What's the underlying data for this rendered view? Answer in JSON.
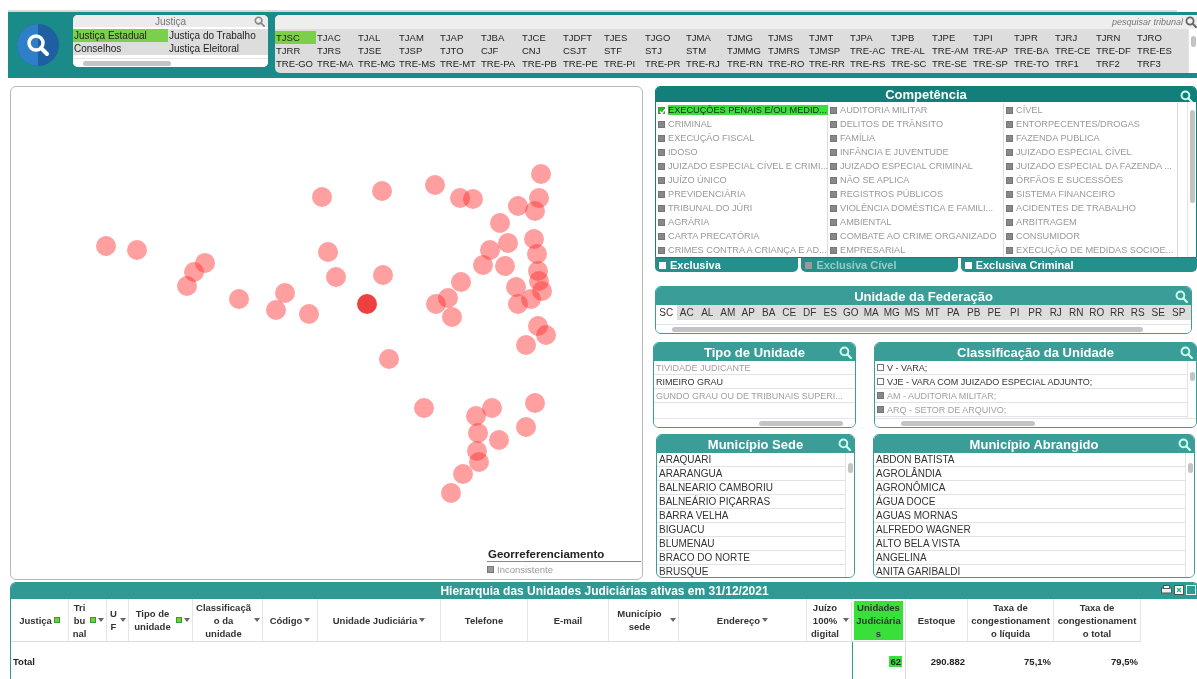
{
  "justica": {
    "title": "Justiça",
    "items": [
      {
        "label": "Justiça Estadual",
        "selected": true
      },
      {
        "label": "Justiça do Trabalho",
        "selected": false
      },
      {
        "label": "Conselhos",
        "selected": false
      },
      {
        "label": "Justiça Eleitoral",
        "selected": false
      }
    ]
  },
  "tribunal": {
    "placeholder": "pesquisar tribunal",
    "items": [
      {
        "label": "TJSC",
        "selected": true
      },
      {
        "label": "TJAC",
        "selected": false
      },
      {
        "label": "TJAL",
        "selected": false
      },
      {
        "label": "TJAM",
        "selected": false
      },
      {
        "label": "TJAP",
        "selected": false
      },
      {
        "label": "TJBA",
        "selected": false
      },
      {
        "label": "TJCE",
        "selected": false
      },
      {
        "label": "TJDFT",
        "selected": false
      },
      {
        "label": "TJES",
        "selected": false
      },
      {
        "label": "TJGO",
        "selected": false
      },
      {
        "label": "TJMA",
        "selected": false
      },
      {
        "label": "TJMG",
        "selected": false
      },
      {
        "label": "TJMS",
        "selected": false
      },
      {
        "label": "TJMT",
        "selected": false
      },
      {
        "label": "TJPA",
        "selected": false
      },
      {
        "label": "TJPB",
        "selected": false
      },
      {
        "label": "TJPE",
        "selected": false
      },
      {
        "label": "TJPI",
        "selected": false
      },
      {
        "label": "TJPR",
        "selected": false
      },
      {
        "label": "TJRJ",
        "selected": false
      },
      {
        "label": "TJRN",
        "selected": false
      },
      {
        "label": "TJRO",
        "selected": false
      },
      {
        "label": "TJRR",
        "selected": false
      },
      {
        "label": "TJRS",
        "selected": false
      },
      {
        "label": "TJSE",
        "selected": false
      },
      {
        "label": "TJSP",
        "selected": false
      },
      {
        "label": "TJTO",
        "selected": false
      },
      {
        "label": "CJF",
        "selected": false
      },
      {
        "label": "CNJ",
        "selected": false
      },
      {
        "label": "CSJT",
        "selected": false
      },
      {
        "label": "STF",
        "selected": false
      },
      {
        "label": "STJ",
        "selected": false
      },
      {
        "label": "STM",
        "selected": false
      },
      {
        "label": "TJMMG",
        "selected": false
      },
      {
        "label": "TJMRS",
        "selected": false
      },
      {
        "label": "TJMSP",
        "selected": false
      },
      {
        "label": "TRE-AC",
        "selected": false
      },
      {
        "label": "TRE-AL",
        "selected": false
      },
      {
        "label": "TRE-AM",
        "selected": false
      },
      {
        "label": "TRE-AP",
        "selected": false
      },
      {
        "label": "TRE-BA",
        "selected": false
      },
      {
        "label": "TRE-CE",
        "selected": false
      },
      {
        "label": "TRE-DF",
        "selected": false
      },
      {
        "label": "TRE-ES",
        "selected": false
      },
      {
        "label": "TRE-GO",
        "selected": false
      },
      {
        "label": "TRE-MA",
        "selected": false
      },
      {
        "label": "TRE-MG",
        "selected": false
      },
      {
        "label": "TRE-MS",
        "selected": false
      },
      {
        "label": "TRE-MT",
        "selected": false
      },
      {
        "label": "TRE-PA",
        "selected": false
      },
      {
        "label": "TRE-PB",
        "selected": false
      },
      {
        "label": "TRE-PE",
        "selected": false
      },
      {
        "label": "TRE-PI",
        "selected": false
      },
      {
        "label": "TRE-PR",
        "selected": false
      },
      {
        "label": "TRE-RJ",
        "selected": false
      },
      {
        "label": "TRE-RN",
        "selected": false
      },
      {
        "label": "TRE-RO",
        "selected": false
      },
      {
        "label": "TRE-RR",
        "selected": false
      },
      {
        "label": "TRE-RS",
        "selected": false
      },
      {
        "label": "TRE-SC",
        "selected": false
      },
      {
        "label": "TRE-SE",
        "selected": false
      },
      {
        "label": "TRE-SP",
        "selected": false
      },
      {
        "label": "TRE-TO",
        "selected": false
      },
      {
        "label": "TRF1",
        "selected": false
      },
      {
        "label": "TRF2",
        "selected": false
      },
      {
        "label": "TRF3",
        "selected": false
      }
    ]
  },
  "map": {
    "legend": {
      "title": "Georreferenciamento",
      "items": [
        {
          "label": "Inconsistente",
          "color": "#999999"
        }
      ]
    }
  },
  "competencia": {
    "title": "Competência",
    "items": [
      {
        "label": "EXECUÇÕES PENAIS E/OU MEDID...",
        "selected": true
      },
      {
        "label": "CRIMINAL",
        "selected": false
      },
      {
        "label": "EXECUÇÃO FISCAL",
        "selected": false
      },
      {
        "label": "IDOSO",
        "selected": false
      },
      {
        "label": "JUIZADO ESPECIAL CÍVEL E CRIMI...",
        "selected": false
      },
      {
        "label": "JUÍZO ÚNICO",
        "selected": false
      },
      {
        "label": "PREVIDENCIÁRIA",
        "selected": false
      },
      {
        "label": "TRIBUNAL DO JÚRI",
        "selected": false
      },
      {
        "label": "AGRÁRIA",
        "selected": false
      },
      {
        "label": "CARTA PRECATÓRIA",
        "selected": false
      },
      {
        "label": "CRIMES CONTRA A CRIANÇA E AD...",
        "selected": false
      },
      {
        "label": "AUDITORIA MILITAR",
        "selected": false
      },
      {
        "label": "DELITOS DE TRÂNSITO",
        "selected": false
      },
      {
        "label": "FAMÍLIA",
        "selected": false
      },
      {
        "label": "INFÂNCIA E JUVENTUDE",
        "selected": false
      },
      {
        "label": "JUIZADO ESPECIAL CRIMINAL",
        "selected": false
      },
      {
        "label": "NÃO SE APLICA",
        "selected": false
      },
      {
        "label": "REGISTROS PÚBLICOS",
        "selected": false
      },
      {
        "label": "VIOLÊNCIA DOMÉSTICA E FAMILI...",
        "selected": false
      },
      {
        "label": "AMBIENTAL",
        "selected": false
      },
      {
        "label": "COMBATE AO CRIME ORGANIZADO",
        "selected": false
      },
      {
        "label": "EMPRESARIAL",
        "selected": false
      },
      {
        "label": "CÍVEL",
        "selected": false
      },
      {
        "label": "ENTORPECENTES/DROGAS",
        "selected": false
      },
      {
        "label": "FAZENDA PUBLICA",
        "selected": false
      },
      {
        "label": "JUIZADO ESPECIAL CÍVEL",
        "selected": false
      },
      {
        "label": "JUIZADO ESPECIAL DA FAZENDA ...",
        "selected": false
      },
      {
        "label": "ÓRFÃOS E SUCESSÕES",
        "selected": false
      },
      {
        "label": "SISTEMA FINANCEIRO",
        "selected": false
      },
      {
        "label": "ACIDENTES DE TRABALHO",
        "selected": false
      },
      {
        "label": "ARBITRAGEM",
        "selected": false
      },
      {
        "label": "CONSUMIDOR",
        "selected": false
      },
      {
        "label": "EXECUÇÃO DE MEDIDAS SOCIOE...",
        "selected": false
      }
    ],
    "toggles": [
      {
        "label": "Exclusiva",
        "checked": false,
        "disabled": false
      },
      {
        "label": "Exclusiva Cível",
        "checked": false,
        "disabled": true
      },
      {
        "label": "Exclusiva Criminal",
        "checked": false,
        "disabled": false
      }
    ]
  },
  "uf": {
    "title": "Unidade da Federação",
    "items": [
      {
        "label": "SC",
        "excluded": false
      },
      {
        "label": "AC",
        "excluded": true
      },
      {
        "label": "AL",
        "excluded": true
      },
      {
        "label": "AM",
        "excluded": true
      },
      {
        "label": "AP",
        "excluded": true
      },
      {
        "label": "BA",
        "excluded": true
      },
      {
        "label": "CE",
        "excluded": true
      },
      {
        "label": "DF",
        "excluded": true
      },
      {
        "label": "ES",
        "excluded": true
      },
      {
        "label": "GO",
        "excluded": true
      },
      {
        "label": "MA",
        "excluded": true
      },
      {
        "label": "MG",
        "excluded": true
      },
      {
        "label": "MS",
        "excluded": true
      },
      {
        "label": "MT",
        "excluded": true
      },
      {
        "label": "PA",
        "excluded": true
      },
      {
        "label": "PB",
        "excluded": true
      },
      {
        "label": "PE",
        "excluded": true
      },
      {
        "label": "PI",
        "excluded": true
      },
      {
        "label": "PR",
        "excluded": true
      },
      {
        "label": "RJ",
        "excluded": true
      },
      {
        "label": "RN",
        "excluded": true
      },
      {
        "label": "RO",
        "excluded": true
      },
      {
        "label": "RR",
        "excluded": true
      },
      {
        "label": "RS",
        "excluded": true
      },
      {
        "label": "SE",
        "excluded": true
      },
      {
        "label": "SP",
        "excluded": true
      }
    ]
  },
  "tipo_unidade": {
    "title": "Tipo de Unidade",
    "items": [
      {
        "label": "TIVIDADE JUDICANTE",
        "excluded": true
      },
      {
        "label": "RIMEIRO GRAU",
        "excluded": false
      },
      {
        "label": "GUNDO GRAU OU DE TRIBUNAIS SUPERI...",
        "excluded": true
      }
    ]
  },
  "classificacao": {
    "title": "Classificação da Unidade",
    "items": [
      {
        "label": "V - VARA;",
        "excluded": false
      },
      {
        "label": "VJE - VARA COM JUIZADO ESPECIAL ADJUNTO;",
        "excluded": false
      },
      {
        "label": "AM - AUDITORIA MILITAR;",
        "excluded": true
      },
      {
        "label": "ARQ - SETOR DE ARQUIVO;",
        "excluded": true
      }
    ]
  },
  "municipio_sede": {
    "title": "Município Sede",
    "items": [
      {
        "label": "ARAQUARI"
      },
      {
        "label": "ARARANGUA"
      },
      {
        "label": "BALNEARIO CAMBORIU"
      },
      {
        "label": "BALNEÁRIO PIÇARRAS"
      },
      {
        "label": "BARRA VELHA"
      },
      {
        "label": "BIGUACU"
      },
      {
        "label": "BLUMENAU"
      },
      {
        "label": "BRACO DO NORTE"
      },
      {
        "label": "BRUSQUE"
      }
    ]
  },
  "municipio_abrangido": {
    "title": "Município Abrangido",
    "items": [
      {
        "label": "ABDON BATISTA"
      },
      {
        "label": "AGROLÂNDIA"
      },
      {
        "label": "AGRONÔMICA"
      },
      {
        "label": "ÁGUA DOCE"
      },
      {
        "label": "AGUAS MORNAS"
      },
      {
        "label": "ALFREDO WAGNER"
      },
      {
        "label": "ALTO BELA VISTA"
      },
      {
        "label": "ANGELINA"
      },
      {
        "label": "ANITA GARIBALDI"
      }
    ]
  },
  "table": {
    "title": "Hierarquia das Unidades Judiciárias ativas em 31/12/2021",
    "columns": [
      {
        "label": "Justiça",
        "filtered": true,
        "sortable": false,
        "highlighted": false
      },
      {
        "label": "Tribunal",
        "filtered": true,
        "sortable": true,
        "highlighted": false
      },
      {
        "label": "UF",
        "filtered": false,
        "sortable": true,
        "highlighted": false
      },
      {
        "label": "Tipo de unidade",
        "filtered": true,
        "sortable": true,
        "highlighted": false
      },
      {
        "label": "Classificação da unidade",
        "filtered": false,
        "sortable": true,
        "highlighted": false
      },
      {
        "label": "Código",
        "filtered": false,
        "sortable": true,
        "highlighted": false
      },
      {
        "label": "Unidade Judiciária",
        "filtered": false,
        "sortable": true,
        "highlighted": false
      },
      {
        "label": "Telefone",
        "filtered": false,
        "sortable": false,
        "highlighted": false
      },
      {
        "label": "E-mail",
        "filtered": false,
        "sortable": false,
        "highlighted": false
      },
      {
        "label": "Município sede",
        "filtered": false,
        "sortable": true,
        "highlighted": false
      },
      {
        "label": "Endereço",
        "filtered": false,
        "sortable": true,
        "highlighted": false
      },
      {
        "label": "Juízo 100% digital",
        "filtered": false,
        "sortable": true,
        "highlighted": false
      },
      {
        "label": "Unidades Judiciárias",
        "filtered": false,
        "sortable": false,
        "highlighted": true
      },
      {
        "label": "Estoque",
        "filtered": false,
        "sortable": false,
        "highlighted": false
      },
      {
        "label": "Taxa de congestionamento líquida",
        "filtered": false,
        "sortable": false,
        "highlighted": false
      },
      {
        "label": "Taxa de congestionamento total",
        "filtered": false,
        "sortable": false,
        "highlighted": false
      }
    ],
    "total_row": {
      "label": "Total",
      "cells": [
        {
          "value": "62",
          "highlighted": true
        },
        {
          "value": "290.882",
          "highlighted": false
        },
        {
          "value": "75,1%",
          "highlighted": false
        },
        {
          "value": "79,5%",
          "highlighted": false
        }
      ]
    }
  }
}
